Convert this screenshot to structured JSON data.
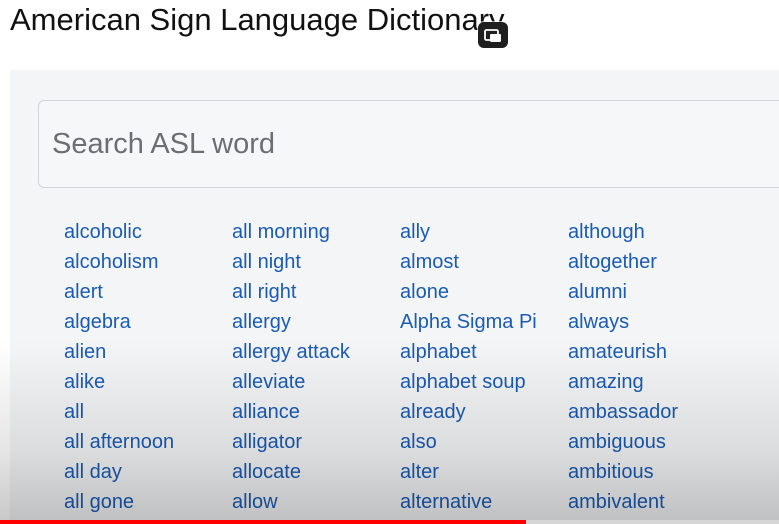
{
  "title": "American Sign Language Dictionary",
  "pip_icon": "picture-in-picture-icon",
  "search": {
    "placeholder": "Search ASL word",
    "value": ""
  },
  "columns": [
    [
      "alcoholic",
      "alcoholism",
      "alert",
      "algebra",
      "alien",
      "alike",
      "all",
      "all afternoon",
      "all day",
      "all gone"
    ],
    [
      "all morning",
      "all night",
      "all right",
      "allergy",
      "allergy attack",
      "alleviate",
      "alliance",
      "alligator",
      "allocate",
      "allow"
    ],
    [
      "ally",
      "almost",
      "alone",
      "Alpha Sigma Pi",
      "alphabet",
      "alphabet soup",
      "already",
      "also",
      "alter",
      "alternative"
    ],
    [
      "although",
      "altogether",
      "alumni",
      "always",
      "amateurish",
      "amazing",
      "ambassador",
      "ambiguous",
      "ambitious",
      "ambivalent"
    ]
  ],
  "video_progress": {
    "fraction": 0.675,
    "color": "#ff0000"
  },
  "colors": {
    "link": "#1a5bb5",
    "panel": "#f4f5f6"
  }
}
